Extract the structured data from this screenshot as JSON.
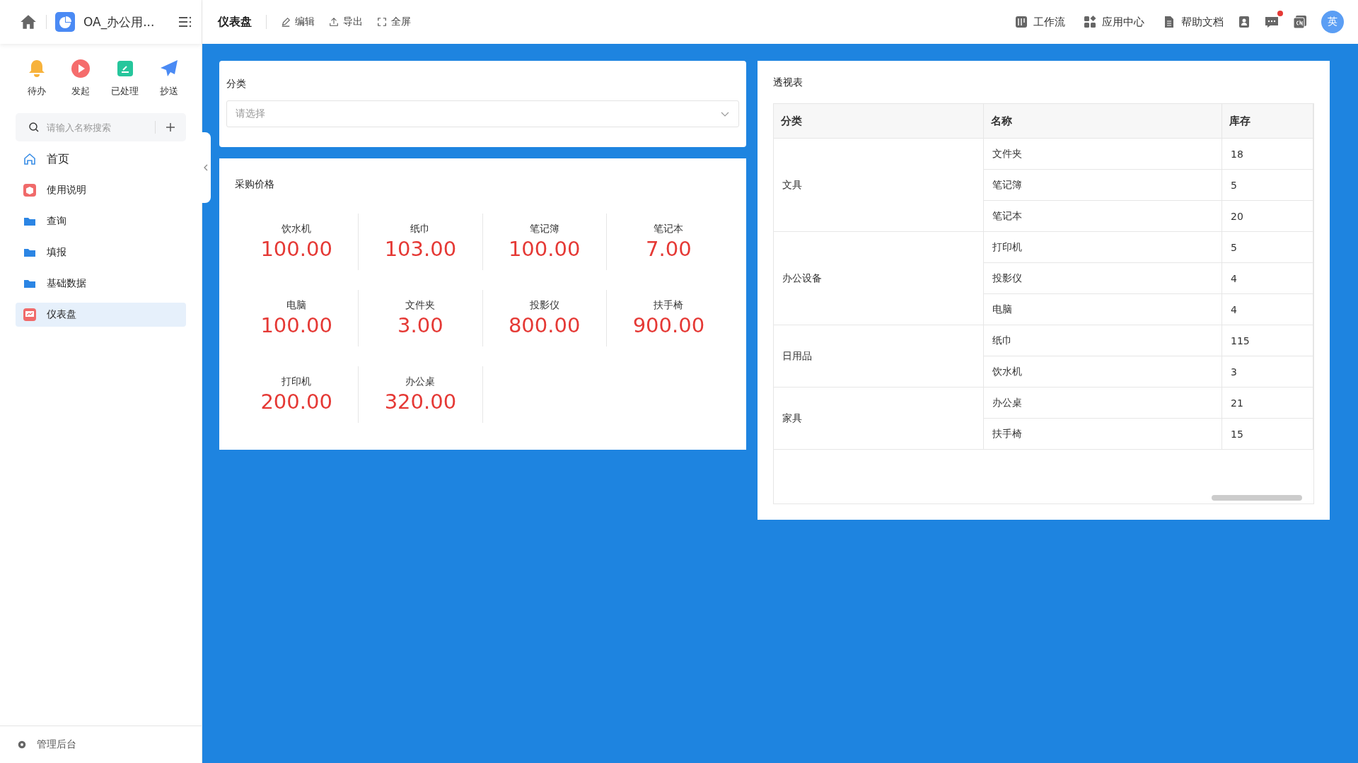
{
  "sidebar": {
    "app_title": "OA_办公用...",
    "shortcuts": [
      {
        "label": "待办",
        "kind": "bell"
      },
      {
        "label": "发起",
        "kind": "play"
      },
      {
        "label": "已处理",
        "kind": "done"
      },
      {
        "label": "抄送",
        "kind": "send"
      }
    ],
    "search": {
      "placeholder": "请输入名称搜索"
    },
    "nav": [
      {
        "label": "首页",
        "kind": "home",
        "selected": false
      },
      {
        "label": "使用说明",
        "kind": "doc",
        "selected": false
      },
      {
        "label": "查询",
        "kind": "folder",
        "selected": false
      },
      {
        "label": "填报",
        "kind": "folder",
        "selected": false
      },
      {
        "label": "基础数据",
        "kind": "folder",
        "selected": false
      },
      {
        "label": "仪表盘",
        "kind": "dashboard",
        "selected": true
      }
    ],
    "footer": "管理后台"
  },
  "topbar": {
    "title": "仪表盘",
    "actions": [
      {
        "label": "编辑",
        "kind": "edit"
      },
      {
        "label": "导出",
        "kind": "export"
      },
      {
        "label": "全屏",
        "kind": "fullscreen"
      }
    ],
    "links": [
      {
        "label": "工作流",
        "kind": "flow"
      },
      {
        "label": "应用中心",
        "kind": "apps"
      },
      {
        "label": "帮助文档",
        "kind": "docs"
      }
    ],
    "avatar": "英",
    "message_unread": true
  },
  "filter": {
    "label": "分类",
    "placeholder": "请选择"
  },
  "prices": {
    "title": "采购价格",
    "items": [
      {
        "name": "饮水机",
        "value": "100.00"
      },
      {
        "name": "纸巾",
        "value": "103.00"
      },
      {
        "name": "笔记簿",
        "value": "100.00"
      },
      {
        "name": "笔记本",
        "value": "7.00"
      },
      {
        "name": "电脑",
        "value": "100.00"
      },
      {
        "name": "文件夹",
        "value": "3.00"
      },
      {
        "name": "投影仪",
        "value": "800.00"
      },
      {
        "name": "扶手椅",
        "value": "900.00"
      },
      {
        "name": "打印机",
        "value": "200.00"
      },
      {
        "name": "办公桌",
        "value": "320.00"
      }
    ]
  },
  "pivot": {
    "title": "透视表",
    "columns": [
      "分类",
      "名称",
      "库存"
    ],
    "groups": [
      {
        "category": "文具",
        "rows": [
          {
            "name": "文件夹",
            "stock": "18"
          },
          {
            "name": "笔记簿",
            "stock": "5"
          },
          {
            "name": "笔记本",
            "stock": "20"
          }
        ]
      },
      {
        "category": "办公设备",
        "rows": [
          {
            "name": "打印机",
            "stock": "5"
          },
          {
            "name": "投影仪",
            "stock": "4"
          },
          {
            "name": "电脑",
            "stock": "4"
          }
        ]
      },
      {
        "category": "日用品",
        "rows": [
          {
            "name": "纸巾",
            "stock": "115"
          },
          {
            "name": "饮水机",
            "stock": "3"
          }
        ]
      },
      {
        "category": "家具",
        "rows": [
          {
            "name": "办公桌",
            "stock": "21"
          },
          {
            "name": "扶手椅",
            "stock": "15"
          }
        ]
      }
    ]
  }
}
